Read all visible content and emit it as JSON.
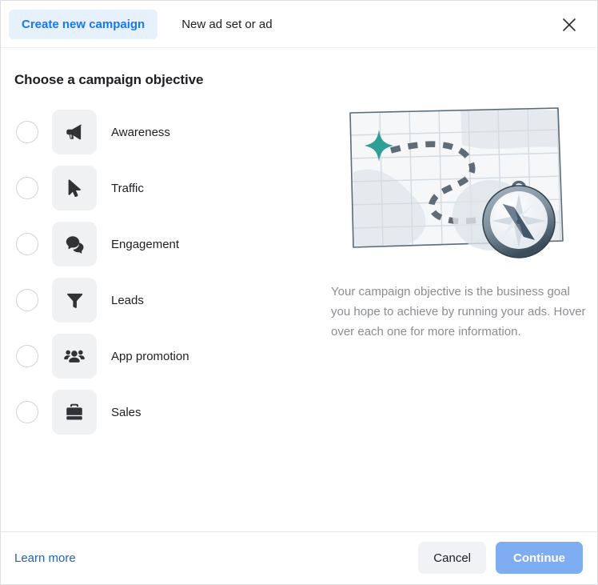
{
  "header": {
    "tab_create_campaign": "Create new campaign",
    "tab_new_adset": "New ad set or ad",
    "close_label": "Close"
  },
  "main": {
    "section_title": "Choose a campaign objective",
    "objectives": [
      {
        "label": "Awareness",
        "icon": "megaphone-icon",
        "selected": false
      },
      {
        "label": "Traffic",
        "icon": "cursor-icon",
        "selected": false
      },
      {
        "label": "Engagement",
        "icon": "chat-bubbles-icon",
        "selected": false
      },
      {
        "label": "Leads",
        "icon": "funnel-icon",
        "selected": false
      },
      {
        "label": "App promotion",
        "icon": "people-icon",
        "selected": false
      },
      {
        "label": "Sales",
        "icon": "briefcase-icon",
        "selected": false
      }
    ],
    "illustration": {
      "name": "map-compass-illustration",
      "star_color": "#2e9e96",
      "compass_rim_color": "#3d4f5c",
      "map_color": "#f4f6f8"
    },
    "description": "Your campaign objective is the business goal you hope to achieve by running your ads. Hover over each one for more information."
  },
  "footer": {
    "learn_more": "Learn more",
    "cancel": "Cancel",
    "continue": "Continue",
    "continue_enabled": false
  },
  "colors": {
    "accent_blue": "#1877f2",
    "tab_active_bg": "#e7f0fd",
    "link_blue": "#2064b4",
    "continue_disabled_bg": "#80adf2",
    "cancel_bg": "#f0f2f5",
    "tile_bg": "#f0f1f3",
    "muted_text": "#8a8d91"
  }
}
